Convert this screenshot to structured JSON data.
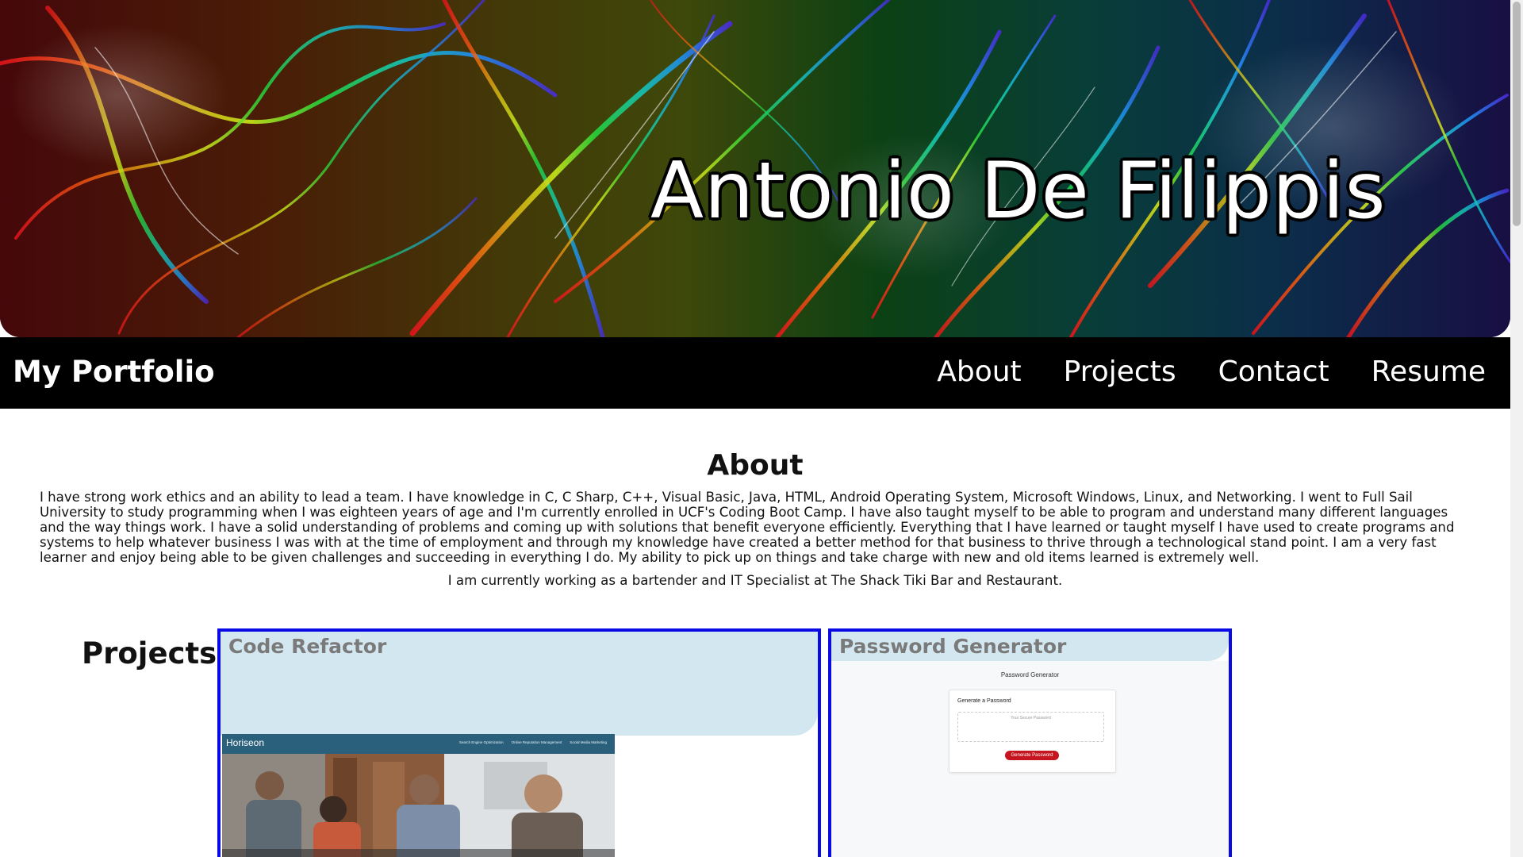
{
  "hero": {
    "name": "Antonio De Filippis"
  },
  "navbar": {
    "brand": "My Portfolio",
    "links": [
      {
        "label": "About"
      },
      {
        "label": "Projects"
      },
      {
        "label": "Contact"
      },
      {
        "label": "Resume"
      }
    ]
  },
  "about": {
    "heading": "About",
    "paragraph": "I have strong work ethics and an ability to lead a team. I have knowledge in C, C Sharp, C++, Visual Basic, Java, HTML, Android Operating System, Microsoft Windows, Linux, and Networking. I went to Full Sail University to study programming when I was eighteen years of age and I'm currently enrolled in UCF's Coding Boot Camp. I have also taught myself to be able to program and understand many different languages and the way things work. I have a solid understanding of problems and coming up with solutions that benefit everyone efficiently. Everything that I have learned or taught myself I have used to create programs and systems to help whatever business I was with at the time of employment and through my knowledge have created a better method for that business to thrive through a technological stand point. I am a very fast learner and enjoy being able to be given challenges and succeeding in everything I do. My ability to pick up on things and take charge with new and old items learned is extremely well.",
    "job": "I am currently working as a bartender and IT Specialist at The Shack Tiki Bar and Restaurant."
  },
  "projects": {
    "heading": "Projects",
    "items": [
      {
        "title": "Code Refactor",
        "preview": {
          "logo": "Horiseon",
          "nav": [
            "Search Engine Optimization",
            "Online Reputation Management",
            "Social Media Marketing"
          ]
        }
      },
      {
        "title": "Password Generator",
        "preview": {
          "title": "Password Generator",
          "card_title": "Generate a Password",
          "placeholder": "Your Secure Password",
          "button": "Generate Password"
        }
      }
    ]
  },
  "colors": {
    "navbar_bg": "#000000",
    "card_border": "#0a0ae6",
    "card_band": "#d3e7f0",
    "generate_button": "#c5151e",
    "horiseon_header": "#2a607c"
  }
}
